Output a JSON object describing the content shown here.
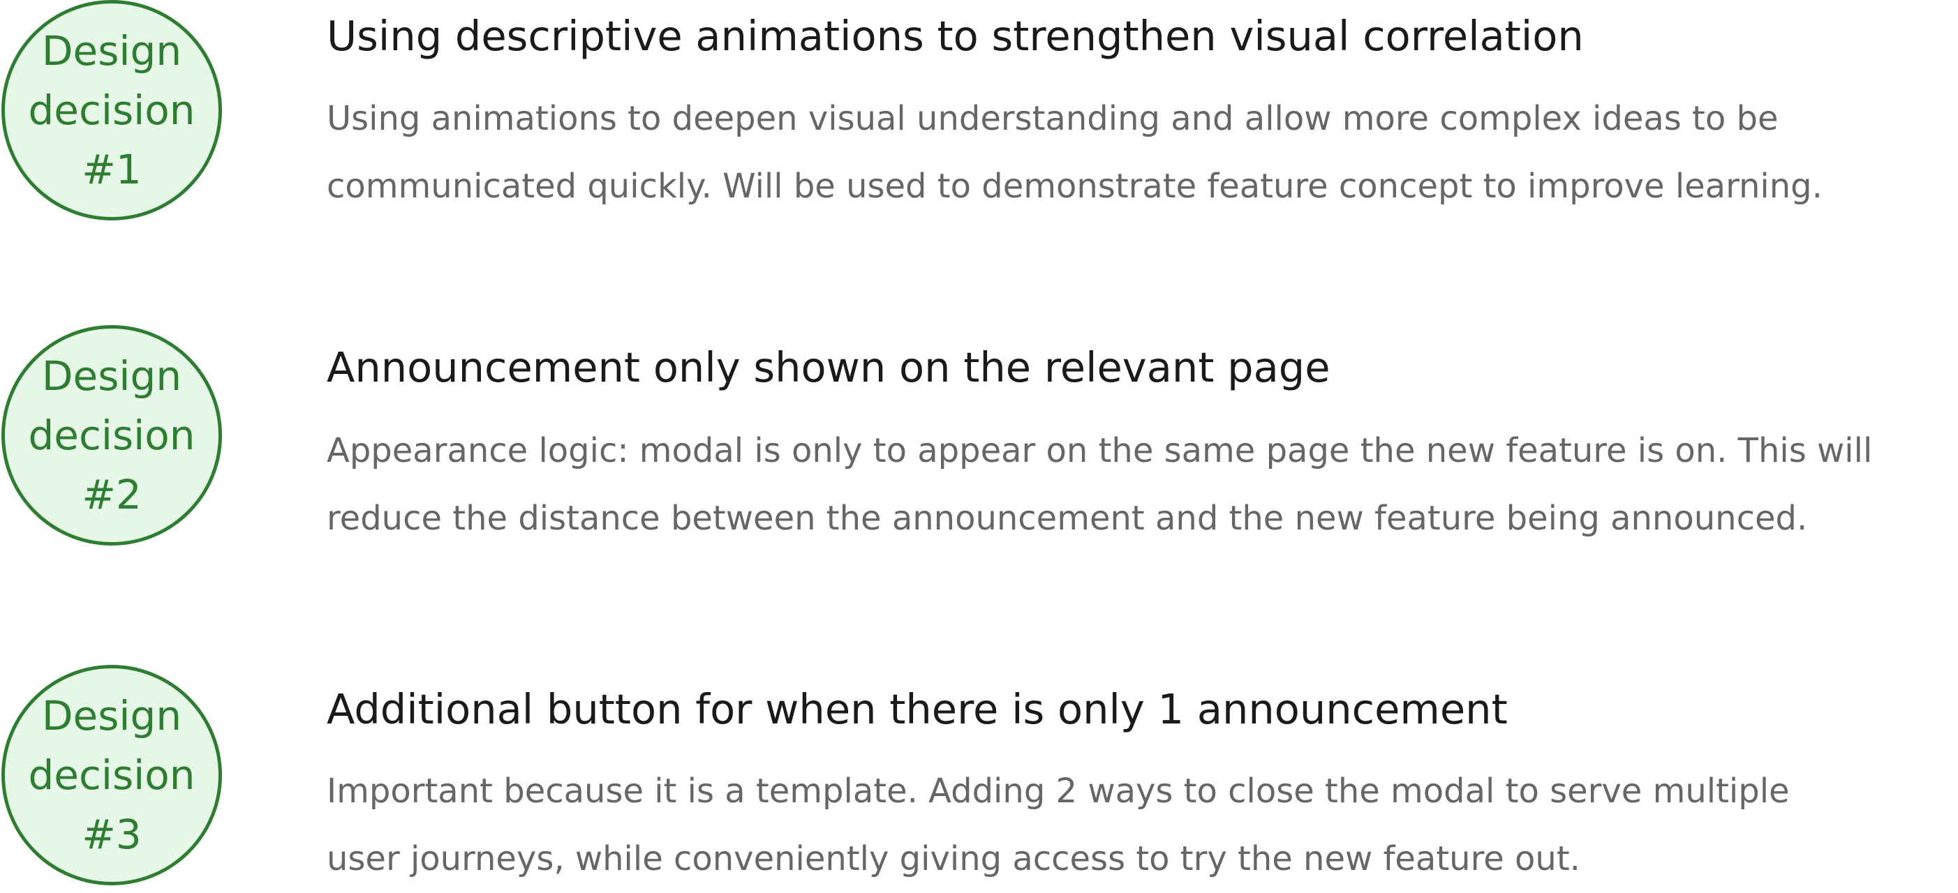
{
  "decisions": [
    {
      "badge": {
        "line1": "Design",
        "line2": "decision",
        "line3": "#1"
      },
      "title": "Using descriptive animations to strengthen visual correlation",
      "description": {
        "line1": "Using animations to deepen visual understanding and allow more complex ideas to be",
        "line2": "communicated quickly. Will be used to demonstrate feature concept to improve learning."
      }
    },
    {
      "badge": {
        "line1": "Design",
        "line2": "decision",
        "line3": "#2"
      },
      "title": "Announcement only shown on the relevant page",
      "description": {
        "line1": "Appearance logic: modal is only to appear on the same page the new feature is on. This will",
        "line2": "reduce the distance between the announcement and the new feature being announced."
      }
    },
    {
      "badge": {
        "line1": "Design",
        "line2": "decision",
        "line3": "#3"
      },
      "title": "Additional button for when there is only 1 announcement",
      "description": {
        "line1": "Important because it is a template. Adding 2 ways to close the modal to serve multiple",
        "line2": "user journeys, while conveniently giving access to try the new feature out."
      }
    }
  ],
  "colors": {
    "badge_border": "#2e7d32",
    "badge_fill": "#e6f7e7",
    "badge_text": "#2e7d32",
    "title_text": "#1a1a1a",
    "description_text": "#666666"
  }
}
